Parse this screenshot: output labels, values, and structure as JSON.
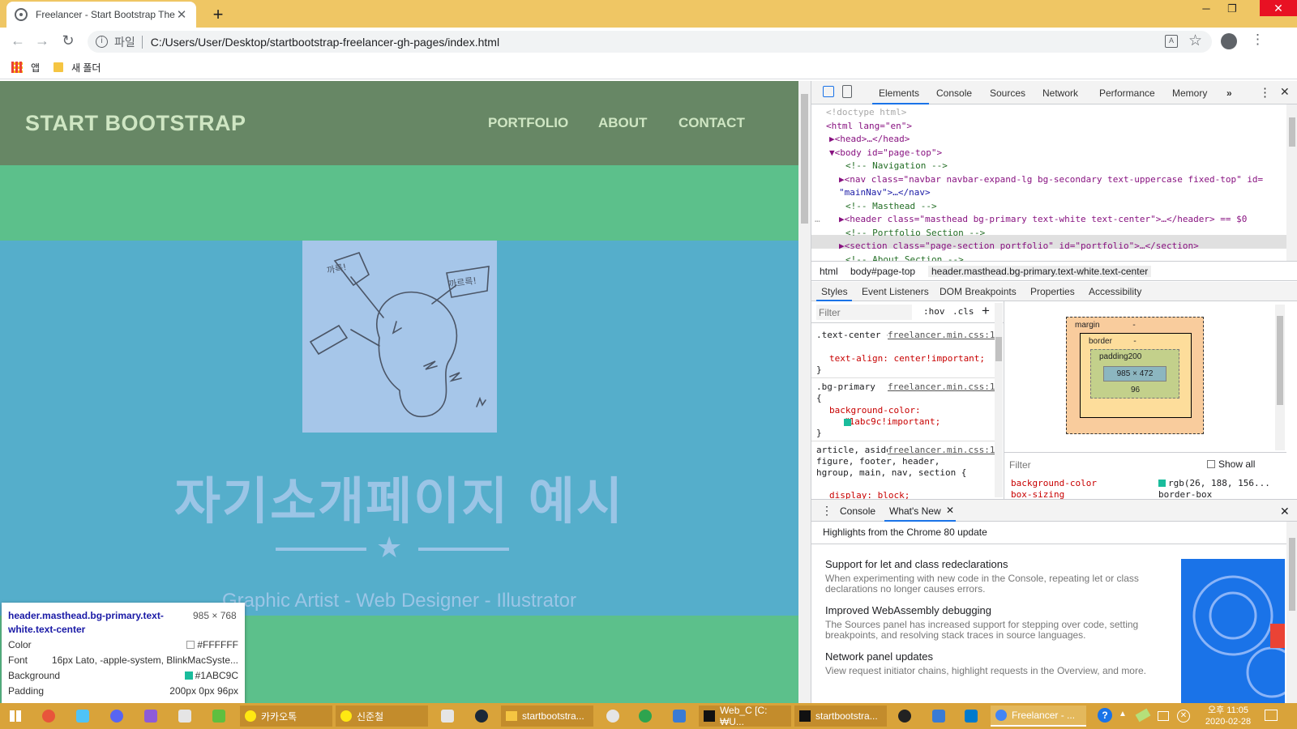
{
  "browser": {
    "tab_title": "Freelancer - Start Bootstrap Theme",
    "address_scheme_label": "파일",
    "url": "C:/Users/User/Desktop/startbootstrap-freelancer-gh-pages/index.html",
    "bookmarks": [
      "앱",
      "새 폴더"
    ]
  },
  "page": {
    "brand": "START BOOTSTRAP",
    "nav_links": [
      "PORTFOLIO",
      "ABOUT",
      "CONTACT"
    ],
    "headline": "자기소개페이지 예시",
    "subtitle": "Graphic Artist - Web Designer - Illustrator",
    "image_texts": [
      "까륵!",
      "까르륵!"
    ],
    "colors": {
      "navbar": "#678765",
      "masthead": "#55aecb",
      "section": "#5cc08b"
    }
  },
  "inspect_tooltip": {
    "selector": "header.masthead.bg-primary.text-white.text-center",
    "dimensions": "985 × 768",
    "rows": [
      {
        "label": "Color",
        "value": "#FFFFFF",
        "swatch": "#FFFFFF"
      },
      {
        "label": "Font",
        "value": "16px Lato, -apple-system, BlinkMacSyste..."
      },
      {
        "label": "Background",
        "value": "#1ABC9C",
        "swatch": "#1ABC9C"
      },
      {
        "label": "Padding",
        "value": "200px 0px 96px"
      }
    ]
  },
  "devtools": {
    "tabs": [
      "Elements",
      "Console",
      "Sources",
      "Network",
      "Performance",
      "Memory"
    ],
    "active_tab": "Elements",
    "dom_lines": [
      "<!doctype html>",
      "<html lang=\"en\">",
      "▶<head>…</head>",
      "▼<body id=\"page-top\">",
      "<!-- Navigation -->",
      "▶<nav class=\"navbar navbar-expand-lg bg-secondary text-uppercase fixed-top\" id=",
      "\"mainNav\">…</nav>",
      "<!-- Masthead -->",
      "▶<header class=\"masthead bg-primary text-white text-center\">…</header> == $0",
      "<!-- Portfolio Section -->",
      "▶<section class=\"page-section portfolio\" id=\"portfolio\">…</section>",
      "<!-- About Section -->"
    ],
    "breadcrumbs": [
      "html",
      "body#page-top",
      "header.masthead.bg-primary.text-white.text-center"
    ],
    "subtabs": [
      "Styles",
      "Event Listeners",
      "DOM Breakpoints",
      "Properties",
      "Accessibility"
    ],
    "styles_filter_placeholder": "Filter",
    "styles_toggles": [
      ":hov",
      ".cls",
      "+"
    ],
    "style_rules": [
      {
        "selector": ".text-center {",
        "source": "freelancer.min.css:10",
        "decl": "text-align: center!important;"
      },
      {
        "selector": ".bg-primary {",
        "source": "freelancer.min.css:10",
        "decl": "background-color: #1abc9c!important;"
      },
      {
        "selector": "article, aside, figcaption, figure, footer, header, hgroup, main, nav, section {",
        "source": "freelancer.min.css:10",
        "decl": "display: block;"
      }
    ],
    "box_model": {
      "margin": "margin",
      "border": "border",
      "padding": "padding200",
      "content": "985 × 472",
      "padding_bottom": "96",
      "dash": "-"
    },
    "computed_filter_placeholder": "Filter",
    "show_all": "Show all",
    "computed": [
      {
        "prop": "background-color",
        "value": "rgb(26, 188, 156..."
      },
      {
        "prop": "box-sizing",
        "value": "border-box"
      }
    ],
    "drawer_tabs": [
      "Console",
      "What's New"
    ],
    "drawer_header": "Highlights from the Chrome 80 update",
    "whats_new": [
      {
        "title": "Support for let and class redeclarations",
        "body": "When experimenting with new code in the Console, repeating let or class declarations no longer causes errors."
      },
      {
        "title": "Improved WebAssembly debugging",
        "body": "The Sources panel has increased support for stepping over code, setting breakpoints, and resolving stack traces in source languages."
      },
      {
        "title": "Network panel updates",
        "body": "View request initiator chains, highlight requests in the Overview, and more."
      }
    ]
  },
  "taskbar": {
    "windows": [
      "카카오톡",
      "신준철",
      "startbootstra...",
      "Web_C [C:₩U...",
      "startbootstra...",
      "Freelancer - ..."
    ],
    "clock_time": "오후 11:05",
    "clock_date": "2020-02-28"
  }
}
